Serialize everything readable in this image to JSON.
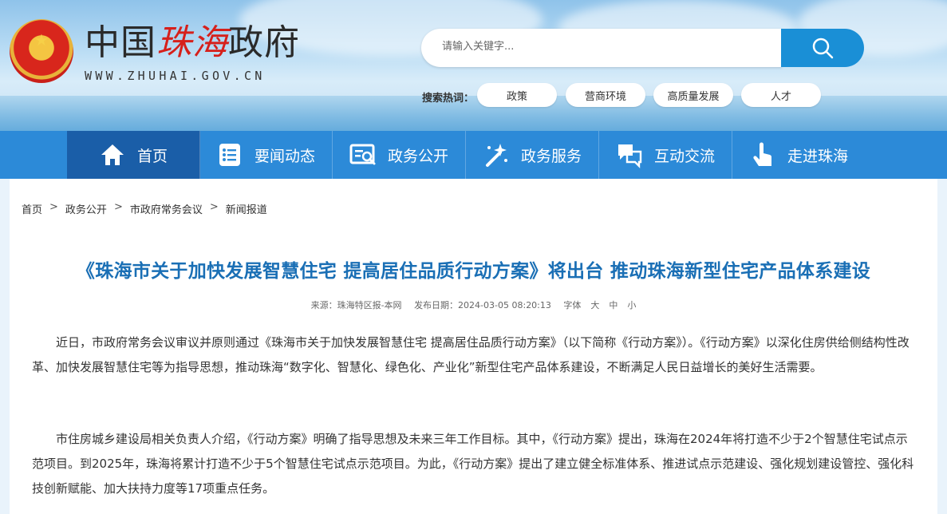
{
  "header": {
    "logo_part1": "中国",
    "logo_part2": "珠海",
    "logo_part3": "政府",
    "logo_url": "WWW.ZHUHAI.GOV.CN",
    "search_placeholder": "请输入关键字...",
    "hot_label": "搜索热词：",
    "hot_tags": [
      "政策",
      "营商环境",
      "高质量发展",
      "人才"
    ]
  },
  "nav": {
    "items": [
      {
        "label": "首页",
        "icon": "home-icon",
        "active": true
      },
      {
        "label": "要闻动态",
        "icon": "news-list-icon"
      },
      {
        "label": "政务公开",
        "icon": "document-search-icon"
      },
      {
        "label": "政务服务",
        "icon": "magic-wand-icon"
      },
      {
        "label": "互动交流",
        "icon": "chat-bubbles-icon"
      },
      {
        "label": "走进珠海",
        "icon": "hand-pointer-icon"
      }
    ]
  },
  "breadcrumb": [
    "首页",
    "政务公开",
    "市政府常务会议",
    "新闻报道"
  ],
  "article": {
    "title": "《珠海市关于加快发展智慧住宅 提高居住品质行动方案》将出台 推动珠海新型住宅产品体系建设",
    "source": "来源：珠海特区报-本网",
    "date": "发布日期：2024-03-05 08:20:13",
    "font_size_label": "字体",
    "font_large": "大",
    "font_medium": "中",
    "font_small": "小",
    "paragraphs": [
      "近日，市政府常务会议审议并原则通过《珠海市关于加快发展智慧住宅 提高居住品质行动方案》（以下简称《行动方案》）。《行动方案》以深化住房供给侧结构性改革、加快发展智慧住宅等为指导思想，推动珠海“数字化、智慧化、绿色化、产业化”新型住宅产品体系建设，不断满足人民日益增长的美好生活需要。",
      "市住房城乡建设局相关负责人介绍，《行动方案》明确了指导思想及未来三年工作目标。其中，《行动方案》提出，珠海在2024年将打造不少于2个智慧住宅试点示范项目。到2025年，珠海将累计打造不少于5个智慧住宅试点示范项目。为此，《行动方案》提出了建立健全标准体系、推进试点示范建设、强化规划建设管控、强化科技创新赋能、加大扶持力度等17项重点任务。"
    ]
  },
  "colors": {
    "nav": "#2c8ad8",
    "nav_active": "#1a5ea8",
    "title": "#1a6fb5",
    "search_button": "#1a8fd6",
    "logo_red": "#d6201b"
  }
}
